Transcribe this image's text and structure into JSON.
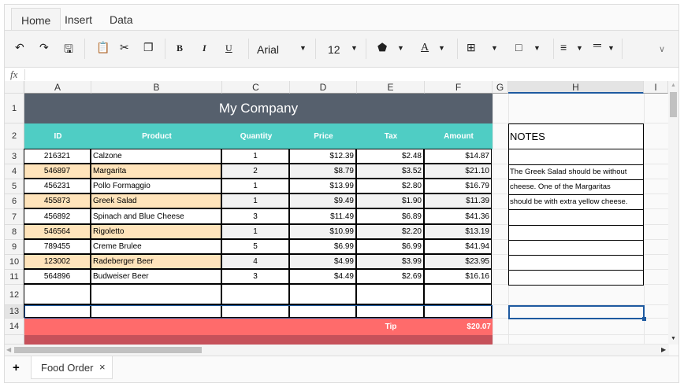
{
  "ribbon": {
    "tabs": [
      "Home",
      "Insert",
      "Data"
    ],
    "font": "Arial",
    "font_size": "12"
  },
  "formula_bar": {
    "fx": "fx",
    "value": ""
  },
  "columns": [
    "A",
    "B",
    "C",
    "D",
    "E",
    "F",
    "G",
    "H",
    "I"
  ],
  "row_numbers": [
    "1",
    "2",
    "3",
    "4",
    "5",
    "6",
    "7",
    "8",
    "9",
    "10",
    "11",
    "12",
    "13",
    "14"
  ],
  "title": "My Company",
  "headers": [
    "ID",
    "Product",
    "Quantity",
    "Price",
    "Tax",
    "Amount"
  ],
  "rows": [
    [
      "216321",
      "Calzone",
      "1",
      "$12.39",
      "$2.48",
      "$14.87"
    ],
    [
      "546897",
      "Margarita",
      "2",
      "$8.79",
      "$3.52",
      "$21.10"
    ],
    [
      "456231",
      "Pollo Formaggio",
      "1",
      "$13.99",
      "$2.80",
      "$16.79"
    ],
    [
      "455873",
      "Greek Salad",
      "1",
      "$9.49",
      "$1.90",
      "$11.39"
    ],
    [
      "456892",
      "Spinach and Blue Cheese",
      "3",
      "$11.49",
      "$6.89",
      "$41.36"
    ],
    [
      "546564",
      "Rigoletto",
      "1",
      "$10.99",
      "$2.20",
      "$13.19"
    ],
    [
      "789455",
      "Creme Brulee",
      "5",
      "$6.99",
      "$6.99",
      "$41.94"
    ],
    [
      "123002",
      "Radeberger Beer",
      "4",
      "$4.99",
      "$3.99",
      "$23.95"
    ],
    [
      "564896",
      "Budweiser Beer",
      "3",
      "$4.49",
      "$2.69",
      "$16.16"
    ]
  ],
  "notes": {
    "title": "NOTES",
    "lines": [
      "The Greek Salad should be without",
      "cheese. One of the Margaritas",
      "should be with extra yellow cheese."
    ]
  },
  "tip": {
    "label": "Tip",
    "value": "$20.07"
  },
  "sheets": {
    "add": "+",
    "tabs": [
      "Food Order"
    ],
    "close": "×"
  },
  "colors": {
    "title_bg": "#56606d",
    "header_bg": "#4fcdc4",
    "highlight": "#ffe4bb",
    "alt": "#f2f2f2",
    "tip_bg": "#ff6b6b",
    "tip_dark": "#c6515a",
    "selection": "#1e5aa0"
  }
}
